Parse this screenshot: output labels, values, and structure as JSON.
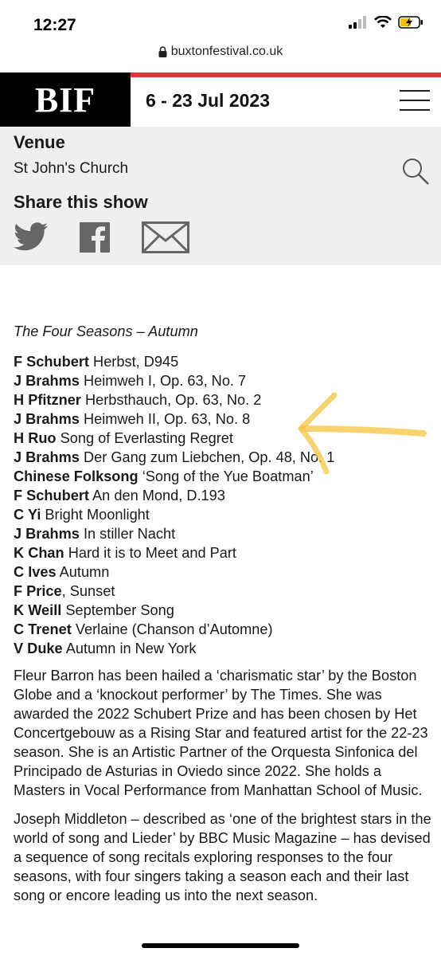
{
  "status_bar": {
    "time": "12:27"
  },
  "browser": {
    "url": "buxtonfestival.co.uk"
  },
  "header": {
    "logo_text": "BIF",
    "dates": "6 - 23 Jul 2023"
  },
  "venue": {
    "heading": "Venue",
    "name": "St John's Church"
  },
  "share": {
    "heading": "Share this show"
  },
  "programme": {
    "title": "The Four Seasons – Autumn",
    "items": [
      {
        "composer": "F Schubert",
        "work": " Herbst, D945"
      },
      {
        "composer": "J Brahms",
        "work": " Heimweh I, Op. 63, No. 7"
      },
      {
        "composer": "H Pfitzner",
        "work": " Herbsthauch, Op. 63, No. 2"
      },
      {
        "composer": "J Brahms",
        "work": " Heimweh II, Op. 63, No. 8"
      },
      {
        "composer": "H Ruo",
        "work": " Song of Everlasting Regret"
      },
      {
        "composer": "J Brahms",
        "work": " Der Gang zum Liebchen, Op. 48, No. 1"
      },
      {
        "composer": "Chinese Folksong",
        "work": " ‘Song of the Yue Boatman’"
      },
      {
        "composer": "F Schubert",
        "work": " An den Mond, D.193"
      },
      {
        "composer": "C Yi",
        "work": " Bright Moonlight"
      },
      {
        "composer": "J Brahms",
        "work": " In stiller Nacht"
      },
      {
        "composer": "K Chan",
        "work": " Hard it is to Meet and Part"
      },
      {
        "composer": "C Ives",
        "work": " Autumn"
      },
      {
        "composer": "F Price",
        "work": ", Sunset"
      },
      {
        "composer": "K Weill",
        "work": " September Song"
      },
      {
        "composer": "C Trenet",
        "work": " Verlaine (Chanson d’Automne)"
      },
      {
        "composer": "V Duke",
        "work": " Autumn in New York"
      }
    ]
  },
  "paragraphs": [
    "Fleur Barron has been hailed a ‘charismatic star’ by the Boston Globe and a ‘knockout performer’ by The Times. She was awarded the 2022 Schubert Prize and has been chosen by Het Concertgebouw as a Rising Star and featured artist for the 22-23 season. She is an Artistic Partner of the Orquesta Sinfonica del Principado de Asturias in Oviedo since 2022. She holds a Masters in Vocal Performance from Manhattan School of Music.",
    "Joseph Middleton – described as ‘one of the brightest stars in the world of song and Lieder’ by BBC Music Magazine – has devised a sequence of song recitals exploring responses to the four seasons, with four singers taking a season each and their last song or encore leading us into the next season."
  ],
  "colors": {
    "accent_red": "#e8333b",
    "highlight_yellow": "#f5c542",
    "icon_grey": "#666666"
  },
  "icons": [
    "twitter-icon",
    "facebook-icon",
    "email-icon",
    "search-icon",
    "menu-icon",
    "lock-icon"
  ]
}
